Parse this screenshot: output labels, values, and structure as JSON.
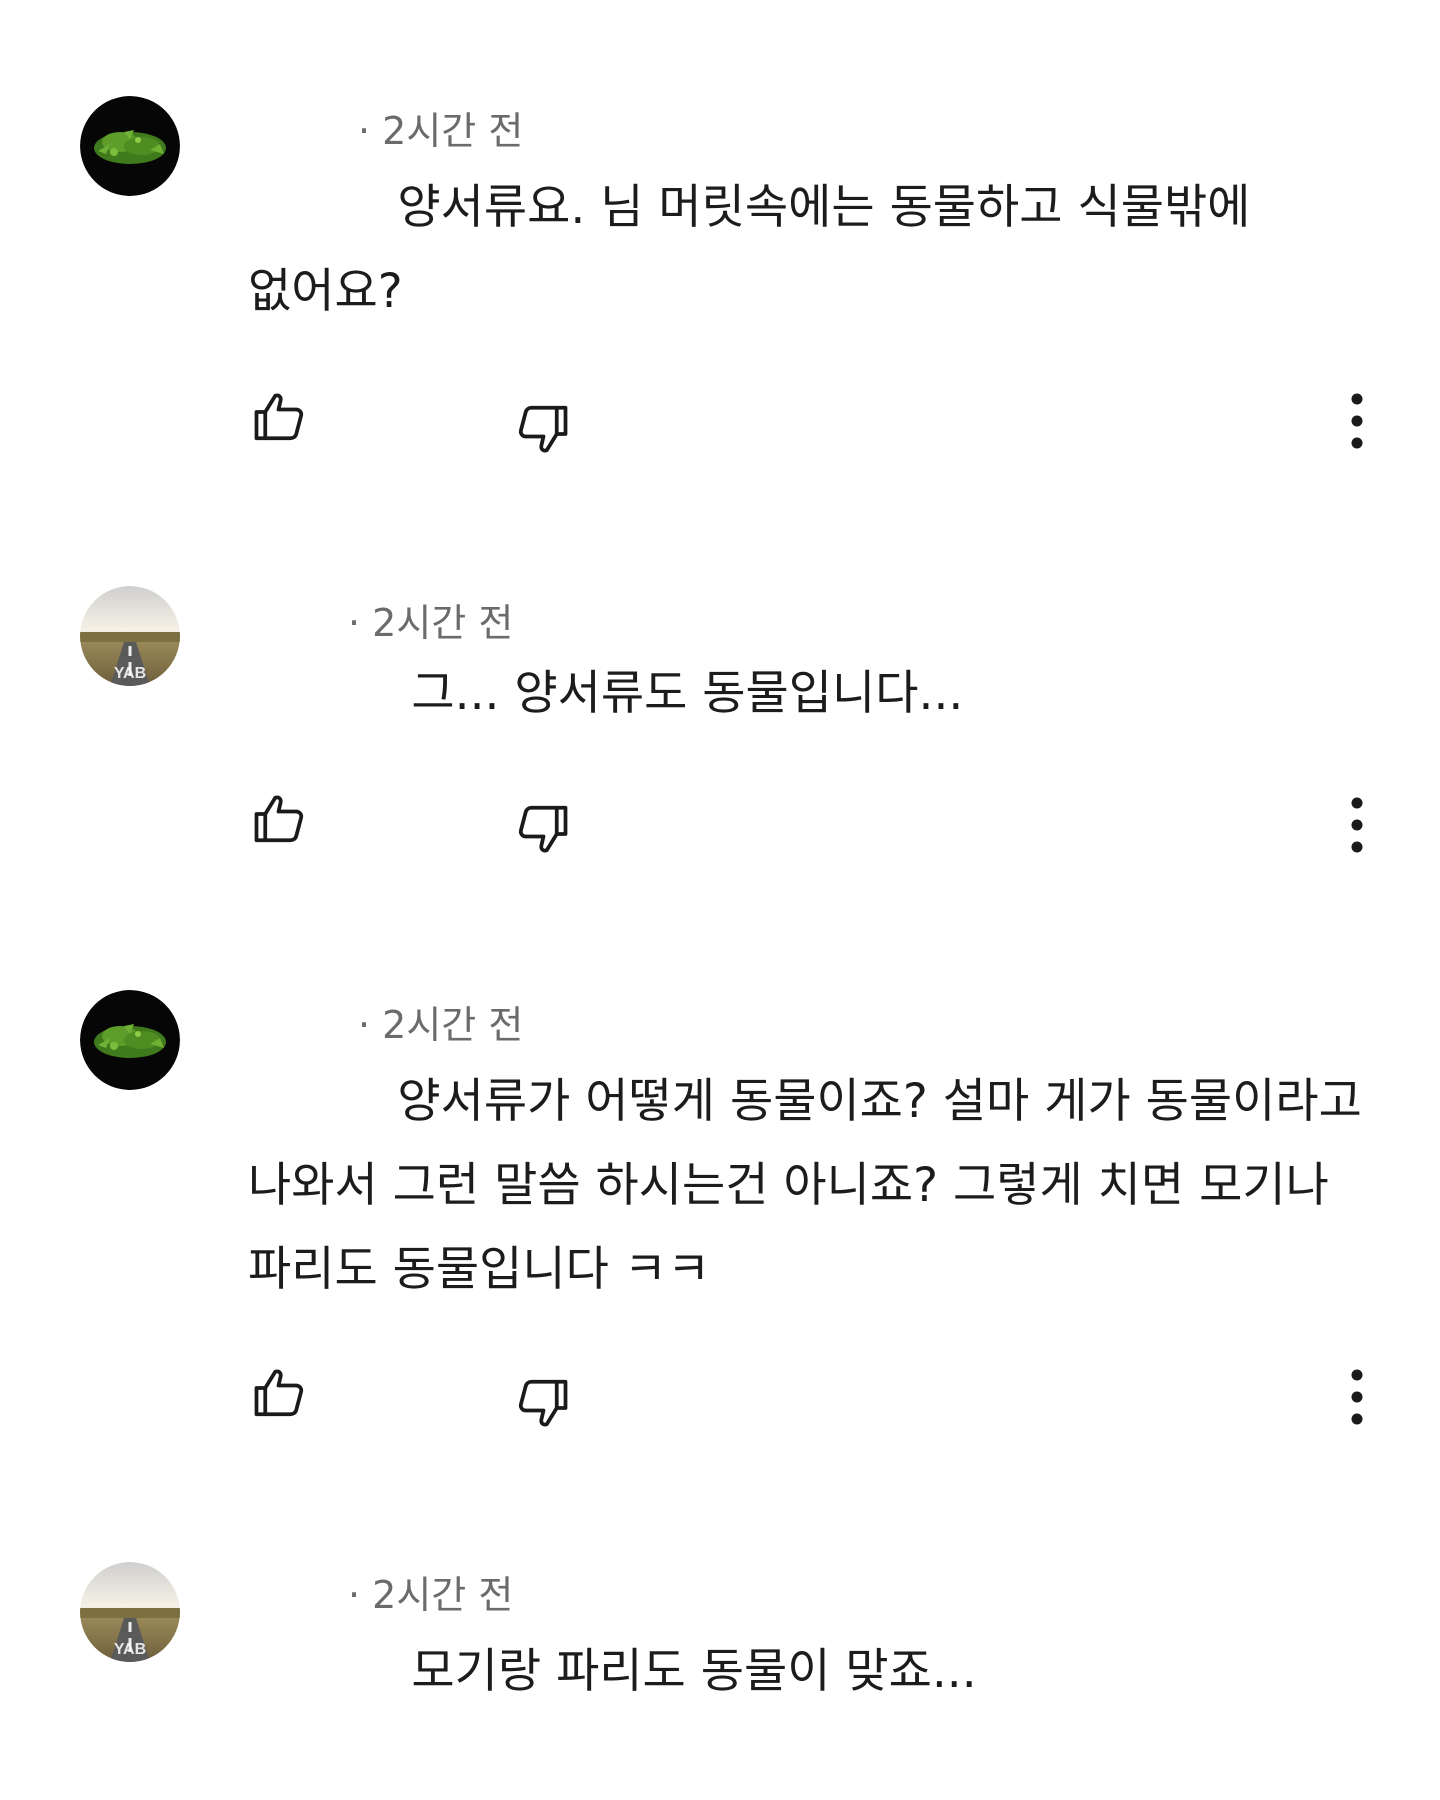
{
  "comments": [
    {
      "avatar": "plant-avatar",
      "timestamp": "· 2시간 전",
      "text": "          양서류요. 님 머릿속에는 동물하고 식물밖에\n없어요?"
    },
    {
      "avatar": "road-avatar",
      "timestamp": "· 2시간 전",
      "text": "          그... 양서류도 동물입니다..."
    },
    {
      "avatar": "plant-avatar",
      "timestamp": "· 2시간 전",
      "text": "          양서류가 어떻게 동물이죠? 설마 게가 동물이라고\n나와서 그런 말씀 하시는건 아니죠? 그렇게 치면 모기나\n파리도 동물입니다 ㅋㅋ"
    },
    {
      "avatar": "road-avatar",
      "timestamp": "· 2시간 전",
      "text": "          모기랑 파리도 동물이 맞죠..."
    }
  ],
  "icons": {
    "like": "thumbs-up-icon",
    "dislike": "thumbs-down-icon",
    "more": "more-vertical-icon"
  }
}
